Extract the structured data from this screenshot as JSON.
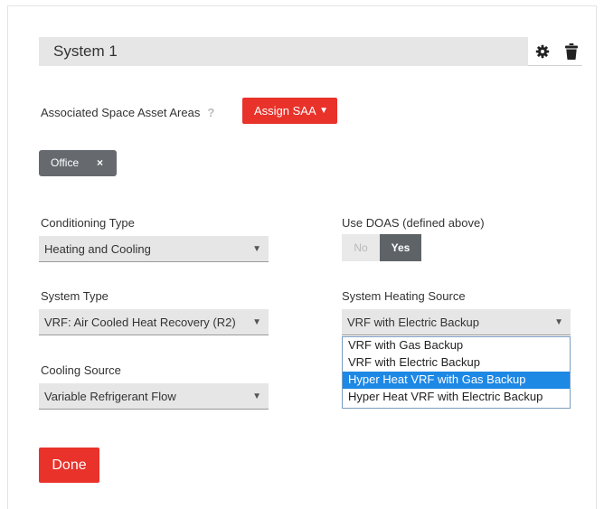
{
  "system": {
    "title": "System 1"
  },
  "saa": {
    "label": "Associated Space Asset Areas",
    "help": "?",
    "button_label": "Assign SAA",
    "caret": "▼",
    "tags": [
      {
        "label": "Office",
        "remove": "×"
      }
    ]
  },
  "conditioning": {
    "label": "Conditioning Type",
    "value": "Heating and Cooling"
  },
  "doas": {
    "label": "Use DOAS (defined above)",
    "no_label": "No",
    "yes_label": "Yes",
    "selected": "Yes"
  },
  "system_type": {
    "label": "System Type",
    "value": "VRF: Air Cooled Heat Recovery (R2)"
  },
  "heating_source": {
    "label": "System Heating Source",
    "value": "VRF with Electric Backup",
    "options": [
      "VRF with Gas Backup",
      "VRF with Electric Backup",
      "Hyper Heat VRF with Gas Backup",
      "Hyper Heat VRF with Electric Backup"
    ],
    "highlighted_index": 2
  },
  "cooling_source": {
    "label": "Cooling Source",
    "value": "Variable Refrigerant Flow"
  },
  "select_arrow": "▼",
  "done_label": "Done",
  "colors": {
    "accent_red": "#e8322a",
    "dark_gray": "#5e6367",
    "highlight_blue": "#1e88e5"
  },
  "icons": {
    "settings": "gear-icon",
    "delete": "trash-icon"
  }
}
